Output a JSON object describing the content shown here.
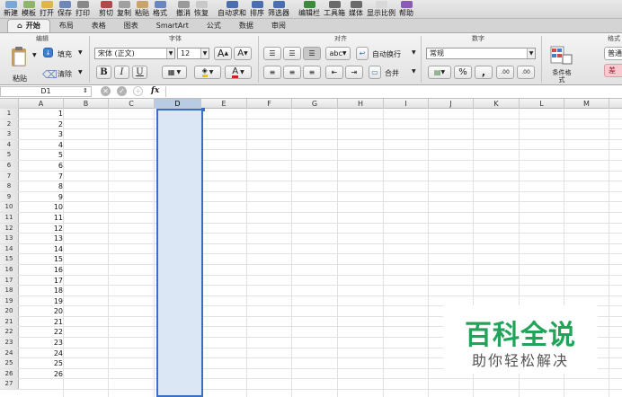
{
  "toolbar": [
    {
      "label": "新建",
      "name": "new-button",
      "icon": "new-doc-icon",
      "color": "#7aa6d8"
    },
    {
      "label": "模板",
      "name": "template-button",
      "icon": "template-icon",
      "color": "#8fb46a"
    },
    {
      "label": "打开",
      "name": "open-button",
      "icon": "folder-icon",
      "color": "#e0b64a"
    },
    {
      "label": "保存",
      "name": "save-button",
      "icon": "save-icon",
      "color": "#6c87b8"
    },
    {
      "label": "打印",
      "name": "print-button",
      "icon": "printer-icon",
      "color": "#888888"
    },
    {
      "label": "剪切",
      "name": "cut-button",
      "icon": "scissors-icon",
      "color": "#b04a4a"
    },
    {
      "label": "复制",
      "name": "copy-button",
      "icon": "copy-icon",
      "color": "#a0a0a0"
    },
    {
      "label": "粘贴",
      "name": "paste-button",
      "icon": "paste-icon",
      "color": "#c9a36b"
    },
    {
      "label": "格式",
      "name": "format-painter-button",
      "icon": "brush-icon",
      "color": "#6a86c0"
    },
    {
      "label": "撤消",
      "name": "undo-button",
      "icon": "undo-icon",
      "color": "#9a9a9a"
    },
    {
      "label": "恢复",
      "name": "redo-button",
      "icon": "redo-icon",
      "color": "#c8c8c8"
    },
    {
      "label": "自动求和",
      "name": "autosum-button",
      "icon": "sigma-icon",
      "color": "#4a6fb0"
    },
    {
      "label": "排序",
      "name": "sort-button",
      "icon": "sort-icon",
      "color": "#4a6fb0"
    },
    {
      "label": "筛选器",
      "name": "filter-button",
      "icon": "funnel-icon",
      "color": "#4a6fb0"
    },
    {
      "label": "编辑栏",
      "name": "formula-bar-toggle",
      "icon": "formula-bar-icon",
      "color": "#3c8a3c"
    },
    {
      "label": "工具箱",
      "name": "toolbox-button",
      "icon": "toolbox-icon",
      "color": "#6a6a6a"
    },
    {
      "label": "媒体",
      "name": "media-button",
      "icon": "media-icon",
      "color": "#6a6a6a"
    },
    {
      "label": "显示比例",
      "name": "zoom-button",
      "icon": "zoom-icon",
      "color": "#d8d8d8"
    },
    {
      "label": "帮助",
      "name": "help-button",
      "icon": "help-icon",
      "color": "#8a5ab8"
    }
  ],
  "tabs": [
    {
      "label": "开始",
      "home_icon": "⌂",
      "active": true
    },
    {
      "label": "布局"
    },
    {
      "label": "表格"
    },
    {
      "label": "图表"
    },
    {
      "label": "SmartArt"
    },
    {
      "label": "公式"
    },
    {
      "label": "数据"
    },
    {
      "label": "审阅"
    }
  ],
  "ribbon": {
    "groups": {
      "edit": "编辑",
      "font": "字体",
      "align": "对齐",
      "number": "数字",
      "format": "格式"
    },
    "paste_label": "粘贴",
    "fill_label": "填充",
    "clear_label": "清除",
    "font_name": "宋体 (正文)",
    "font_size": "12",
    "grow_label": "A",
    "shrink_label": "A",
    "bold": "B",
    "italic": "I",
    "underline": "U",
    "wrap_label": "abc",
    "autowrap_label": "自动换行",
    "merge_label": "合并",
    "number_format": "常规",
    "percent": "%",
    "comma": ",",
    "inc_decimal": ".00",
    "dec_decimal": ".00",
    "cond_format_label": "条件格式",
    "style_normal": "普通",
    "style_bad": "差",
    "accent_color": "#3b6fc4"
  },
  "formula_bar": {
    "name_box": "D1",
    "fx": "fx",
    "x_icon": "cancel-icon",
    "ok_icon": "confirm-icon"
  },
  "columns": [
    "A",
    "B",
    "C",
    "D",
    "E",
    "F",
    "G",
    "H",
    "I",
    "J",
    "K",
    "L",
    "M"
  ],
  "selected_column": "D",
  "rows": [
    {
      "n": "1",
      "a": "1"
    },
    {
      "n": "2",
      "a": "2"
    },
    {
      "n": "3",
      "a": "3"
    },
    {
      "n": "4",
      "a": "4"
    },
    {
      "n": "5",
      "a": "5"
    },
    {
      "n": "6",
      "a": "6"
    },
    {
      "n": "7",
      "a": "7"
    },
    {
      "n": "8",
      "a": "8"
    },
    {
      "n": "9",
      "a": "9"
    },
    {
      "n": "10",
      "a": "10"
    },
    {
      "n": "11",
      "a": "11"
    },
    {
      "n": "12",
      "a": "12"
    },
    {
      "n": "13",
      "a": "13"
    },
    {
      "n": "14",
      "a": "14"
    },
    {
      "n": "15",
      "a": "15"
    },
    {
      "n": "16",
      "a": "16"
    },
    {
      "n": "17",
      "a": "17"
    },
    {
      "n": "18",
      "a": "18"
    },
    {
      "n": "19",
      "a": "19"
    },
    {
      "n": "20",
      "a": "20"
    },
    {
      "n": "21",
      "a": "21"
    },
    {
      "n": "22",
      "a": "22"
    },
    {
      "n": "23",
      "a": "23"
    },
    {
      "n": "24",
      "a": "24"
    },
    {
      "n": "25",
      "a": "25"
    },
    {
      "n": "26",
      "a": "26"
    },
    {
      "n": "27",
      "a": ""
    }
  ],
  "watermark": {
    "title": "百科全说",
    "subtitle": "助你轻松解决"
  }
}
